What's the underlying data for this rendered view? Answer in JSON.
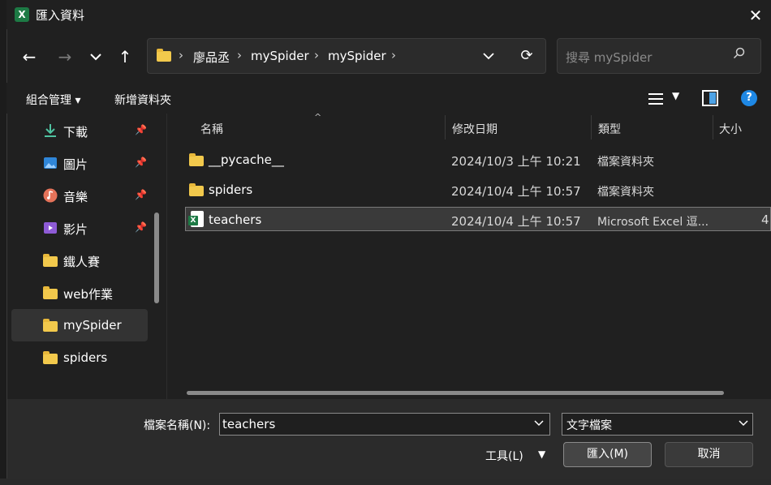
{
  "window": {
    "title": "匯入資料",
    "app_icon": "excel-icon",
    "close_glyph": "✕"
  },
  "nav": {
    "back": "←",
    "forward": "→",
    "recent": "⌄",
    "up": "↑"
  },
  "breadcrumb": [
    "廖品丞",
    "mySpider",
    "mySpider"
  ],
  "breadcrumb_separator": "›",
  "search": {
    "placeholder": "搜尋 mySpider"
  },
  "toolbar": {
    "organize": "組合管理 ▾",
    "new_folder": "新增資料夾",
    "help": "?"
  },
  "sidebar": {
    "items": [
      {
        "label": "下載",
        "icon": "download-icon",
        "pinned": true
      },
      {
        "label": "圖片",
        "icon": "pictures-icon",
        "pinned": true
      },
      {
        "label": "音樂",
        "icon": "music-icon",
        "pinned": true
      },
      {
        "label": "影片",
        "icon": "videos-icon",
        "pinned": true
      },
      {
        "label": "鐵人賽",
        "icon": "folder-icon",
        "pinned": false
      },
      {
        "label": "web作業",
        "icon": "folder-icon",
        "pinned": false
      },
      {
        "label": "mySpider",
        "icon": "folder-icon",
        "pinned": false,
        "selected": true
      },
      {
        "label": "spiders",
        "icon": "folder-icon",
        "pinned": false
      }
    ]
  },
  "columns": {
    "name": "名稱",
    "date": "修改日期",
    "type": "類型",
    "size": "大小"
  },
  "files": [
    {
      "name": "__pycache__",
      "date": "2024/10/3 上午 10:21",
      "type": "檔案資料夾",
      "size": "",
      "icon": "folder-icon"
    },
    {
      "name": "spiders",
      "date": "2024/10/4 上午 10:57",
      "type": "檔案資料夾",
      "size": "",
      "icon": "folder-icon"
    },
    {
      "name": "teachers",
      "date": "2024/10/4 上午 10:57",
      "type": "Microsoft Excel 逗...",
      "size": "4",
      "icon": "excel-file-icon",
      "selected": true
    }
  ],
  "bottom": {
    "filename_label": "檔案名稱(N):",
    "filename_value": "teachers",
    "filetype": "文字檔案",
    "tools": "工具(L)",
    "import_button": "匯入(M)",
    "cancel_button": "取消"
  },
  "colors": {
    "folder": "#f2c94c",
    "excel": "#1d7a45",
    "help": "#1e88e5",
    "background": "#202020"
  }
}
